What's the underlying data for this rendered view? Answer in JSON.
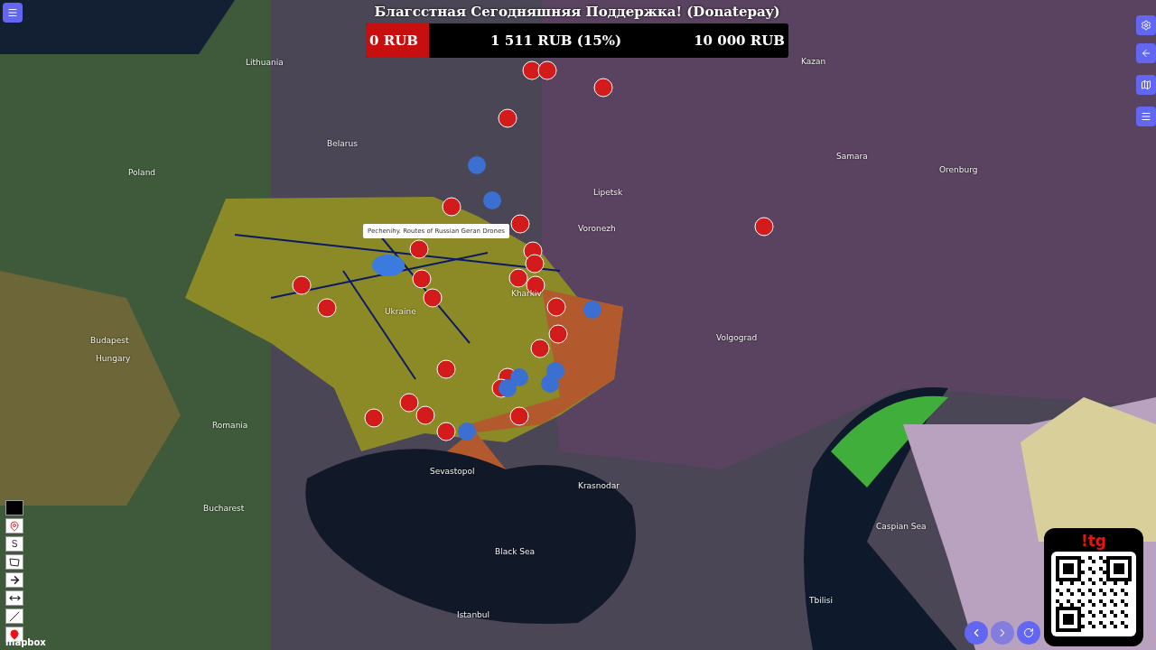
{
  "donation": {
    "title": "Благсстная Сегодняшняя Поддержка! (Donatepay)",
    "min": "0 RUB",
    "current": "1 511 RUB (15%)",
    "max": "10 000 RUB",
    "level": 0.15
  },
  "tooltip": "Pechenihy. Routes of Russian Geran Drones",
  "map_labels": [
    "Lithuania",
    "Belarus",
    "Poland",
    "Ukraine",
    "Kharkiv",
    "Lipetsk",
    "Voronezh",
    "Samara",
    "Orenburg",
    "Volgograd",
    "Hungary",
    "Budapest",
    "Romania",
    "Bucharest",
    "Black Sea",
    "Krasnodar",
    "Sevastopol",
    "Caspian Sea",
    "Tbilisi",
    "Kazan",
    "Istanbul"
  ],
  "draw_tools": [
    {
      "kind": "color"
    },
    {
      "kind": "marker"
    },
    {
      "kind": "text",
      "label": "S"
    },
    {
      "kind": "polygon"
    },
    {
      "kind": "arrow"
    },
    {
      "kind": "measure"
    },
    {
      "kind": "line"
    },
    {
      "kind": "pin"
    }
  ],
  "attribution": "mapbox",
  "qr_card": {
    "title": "!tg"
  }
}
